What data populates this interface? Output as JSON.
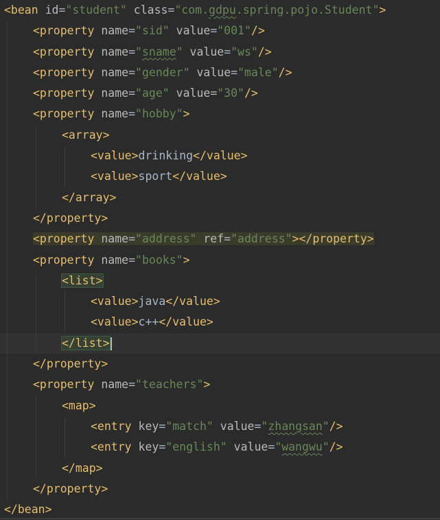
{
  "editor": {
    "language": "xml",
    "theme_colors": {
      "background": "#2b2b2b",
      "tag": "#e8bf6a",
      "attribute": "#bababa",
      "value": "#6a8759",
      "text": "#a9b7c6",
      "current_line": "#323232"
    },
    "lines": [
      {
        "indent": 0,
        "tokens": [
          [
            "tag",
            "<bean"
          ],
          [
            "sp",
            " "
          ],
          [
            "attr",
            "id"
          ],
          [
            "eq",
            "="
          ],
          [
            "val",
            "\"student\""
          ],
          [
            "sp",
            " "
          ],
          [
            "attr",
            "class"
          ],
          [
            "eq",
            "="
          ],
          [
            "val",
            "\"com."
          ],
          [
            "valtypo",
            "gdpu"
          ],
          [
            "val",
            ".spring.pojo.Student\""
          ],
          [
            "tag",
            ">"
          ]
        ]
      },
      {
        "indent": 1,
        "tokens": [
          [
            "tag",
            "<property"
          ],
          [
            "sp",
            " "
          ],
          [
            "attr",
            "name"
          ],
          [
            "eq",
            "="
          ],
          [
            "val",
            "\"sid\""
          ],
          [
            "sp",
            " "
          ],
          [
            "attr",
            "value"
          ],
          [
            "eq",
            "="
          ],
          [
            "val",
            "\"001\""
          ],
          [
            "tag",
            "/>"
          ]
        ]
      },
      {
        "indent": 1,
        "tokens": [
          [
            "tag",
            "<property"
          ],
          [
            "sp",
            " "
          ],
          [
            "attr",
            "name"
          ],
          [
            "eq",
            "="
          ],
          [
            "val",
            "\""
          ],
          [
            "valtypo",
            "sname"
          ],
          [
            "val",
            "\""
          ],
          [
            "sp",
            " "
          ],
          [
            "attr",
            "value"
          ],
          [
            "eq",
            "="
          ],
          [
            "val",
            "\"ws\""
          ],
          [
            "tag",
            "/>"
          ]
        ]
      },
      {
        "indent": 1,
        "tokens": [
          [
            "tag",
            "<property"
          ],
          [
            "sp",
            " "
          ],
          [
            "attr",
            "name"
          ],
          [
            "eq",
            "="
          ],
          [
            "val",
            "\"gender\""
          ],
          [
            "sp",
            " "
          ],
          [
            "attr",
            "value"
          ],
          [
            "eq",
            "="
          ],
          [
            "val",
            "\"male\""
          ],
          [
            "tag",
            "/>"
          ]
        ]
      },
      {
        "indent": 1,
        "tokens": [
          [
            "tag",
            "<property"
          ],
          [
            "sp",
            " "
          ],
          [
            "attr",
            "name"
          ],
          [
            "eq",
            "="
          ],
          [
            "val",
            "\"age\""
          ],
          [
            "sp",
            " "
          ],
          [
            "attr",
            "value"
          ],
          [
            "eq",
            "="
          ],
          [
            "val",
            "\"30\""
          ],
          [
            "tag",
            "/>"
          ]
        ]
      },
      {
        "indent": 1,
        "tokens": [
          [
            "tag",
            "<property"
          ],
          [
            "sp",
            " "
          ],
          [
            "attr",
            "name"
          ],
          [
            "eq",
            "="
          ],
          [
            "val",
            "\"hobby\""
          ],
          [
            "tag",
            ">"
          ]
        ]
      },
      {
        "indent": 2,
        "tokens": [
          [
            "tag",
            "<array>"
          ]
        ]
      },
      {
        "indent": 3,
        "tokens": [
          [
            "tag",
            "<value>"
          ],
          [
            "text",
            "drinking"
          ],
          [
            "tag",
            "</value>"
          ]
        ]
      },
      {
        "indent": 3,
        "tokens": [
          [
            "tag",
            "<value>"
          ],
          [
            "text",
            "sport"
          ],
          [
            "tag",
            "</value>"
          ]
        ]
      },
      {
        "indent": 2,
        "tokens": [
          [
            "tag",
            "</array>"
          ]
        ]
      },
      {
        "indent": 1,
        "tokens": [
          [
            "tag",
            "</property>"
          ]
        ]
      },
      {
        "indent": 1,
        "highlight": "ref",
        "tokens": [
          [
            "tag",
            "<property"
          ],
          [
            "sp",
            " "
          ],
          [
            "attr",
            "name"
          ],
          [
            "eq",
            "="
          ],
          [
            "val",
            "\"address\""
          ],
          [
            "sp",
            " "
          ],
          [
            "attr",
            "ref"
          ],
          [
            "eq",
            "="
          ],
          [
            "val",
            "\"address\""
          ],
          [
            "tag",
            "></property>"
          ]
        ]
      },
      {
        "indent": 1,
        "tokens": [
          [
            "tag",
            "<property"
          ],
          [
            "sp",
            " "
          ],
          [
            "attr",
            "name"
          ],
          [
            "eq",
            "="
          ],
          [
            "val",
            "\"books\""
          ],
          [
            "tag",
            ">"
          ]
        ]
      },
      {
        "indent": 2,
        "tokens": [
          [
            "tagmatch",
            "<list>"
          ]
        ]
      },
      {
        "indent": 3,
        "tokens": [
          [
            "tag",
            "<value>"
          ],
          [
            "text",
            "java"
          ],
          [
            "tag",
            "</value>"
          ]
        ]
      },
      {
        "indent": 3,
        "tokens": [
          [
            "tag",
            "<value>"
          ],
          [
            "text",
            "c++"
          ],
          [
            "tag",
            "</value>"
          ]
        ]
      },
      {
        "indent": 2,
        "current": true,
        "tokens": [
          [
            "tagmatch",
            "</list>"
          ],
          [
            "caret",
            ""
          ]
        ]
      },
      {
        "indent": 1,
        "tokens": [
          [
            "tag",
            "</property>"
          ]
        ]
      },
      {
        "indent": 1,
        "tokens": [
          [
            "tag",
            "<property"
          ],
          [
            "sp",
            " "
          ],
          [
            "attr",
            "name"
          ],
          [
            "eq",
            "="
          ],
          [
            "val",
            "\"teachers\""
          ],
          [
            "tag",
            ">"
          ]
        ]
      },
      {
        "indent": 2,
        "tokens": [
          [
            "tag",
            "<map>"
          ]
        ]
      },
      {
        "indent": 3,
        "tokens": [
          [
            "tag",
            "<entry"
          ],
          [
            "sp",
            " "
          ],
          [
            "attr",
            "key"
          ],
          [
            "eq",
            "="
          ],
          [
            "val",
            "\"match\""
          ],
          [
            "sp",
            " "
          ],
          [
            "attr",
            "value"
          ],
          [
            "eq",
            "="
          ],
          [
            "val",
            "\""
          ],
          [
            "valtypo",
            "zhangsan"
          ],
          [
            "val",
            "\""
          ],
          [
            "tag",
            "/>"
          ]
        ]
      },
      {
        "indent": 3,
        "tokens": [
          [
            "tag",
            "<entry"
          ],
          [
            "sp",
            " "
          ],
          [
            "attr",
            "key"
          ],
          [
            "eq",
            "="
          ],
          [
            "val",
            "\"english\""
          ],
          [
            "sp",
            " "
          ],
          [
            "attr",
            "value"
          ],
          [
            "eq",
            "="
          ],
          [
            "val",
            "\""
          ],
          [
            "valtypo",
            "wangwu"
          ],
          [
            "val",
            "\""
          ],
          [
            "tag",
            "/>"
          ]
        ]
      },
      {
        "indent": 2,
        "tokens": [
          [
            "tag",
            "</map>"
          ]
        ]
      },
      {
        "indent": 1,
        "tokens": [
          [
            "tag",
            "</property>"
          ]
        ]
      },
      {
        "indent": 0,
        "tokens": [
          [
            "tag",
            "</bean>"
          ]
        ]
      }
    ]
  }
}
